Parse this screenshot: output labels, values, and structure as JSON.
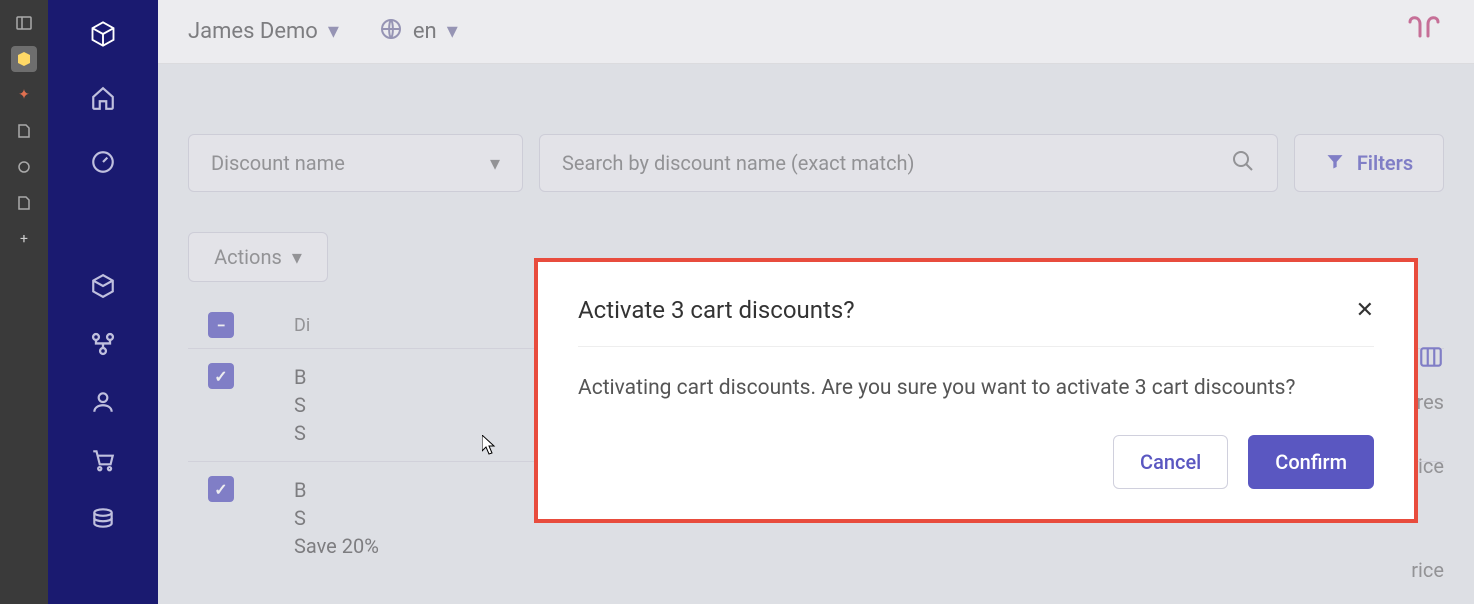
{
  "topbar": {
    "team_label": "James Demo",
    "lang_label": "en"
  },
  "filters": {
    "dropdown_label": "Discount name",
    "search_placeholder": "Search by discount name (exact match)",
    "filters_button": "Filters"
  },
  "table": {
    "actions_label": "Actions",
    "header_name": "Di",
    "stores_header": "Stores",
    "price_label": "rice",
    "rows": [
      {
        "name_fragment": "B\nS\nS"
      },
      {
        "name_fragment": "B\nS\nSave 20%"
      }
    ]
  },
  "modal": {
    "title": "Activate 3 cart discounts?",
    "body": "Activating cart discounts. Are you sure you want to activate 3 cart discounts?",
    "cancel": "Cancel",
    "confirm": "Confirm"
  },
  "icons": {
    "logo": "cube",
    "home": "home",
    "speedometer": "speedometer",
    "cube": "cube",
    "org": "org-chart",
    "user": "user",
    "cart": "cart",
    "coins": "coins"
  }
}
